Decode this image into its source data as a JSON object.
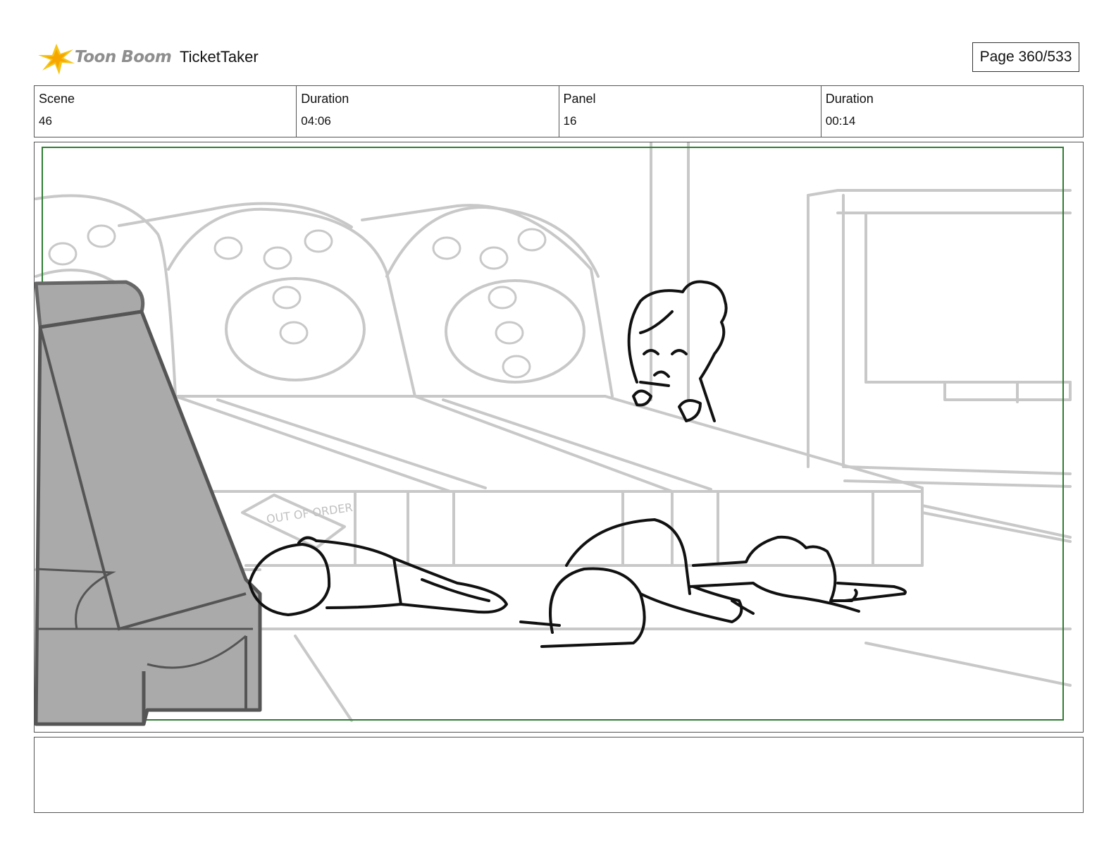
{
  "header": {
    "brand": "Toon Boom",
    "project_title": "TicketTaker",
    "page_label": "Page 360/533"
  },
  "info": {
    "scene_label": "Scene",
    "scene_value": "46",
    "scene_duration_label": "Duration",
    "scene_duration_value": "04:06",
    "panel_label": "Panel",
    "panel_value": "16",
    "panel_duration_label": "Duration",
    "panel_duration_value": "00:14"
  },
  "sketch": {
    "sign_text": "OUT OF ORDER"
  },
  "colors": {
    "safe_frame": "#2e7d32",
    "background_lines": "#c8c8c8",
    "seat_fill": "#aaaaaa",
    "ink": "#111111"
  },
  "notes": {
    "text": ""
  }
}
